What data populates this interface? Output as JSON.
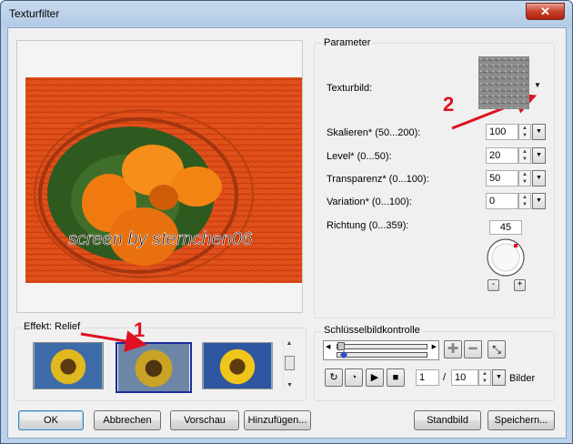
{
  "window": {
    "title": "Texturfilter",
    "close_label": "✕"
  },
  "effect": {
    "label": "Effekt: Relief"
  },
  "preview": {
    "watermark": "screen by sternchen06"
  },
  "annotations": {
    "arrow1_label": "1",
    "arrow2_label": "2",
    "color": "#e01020"
  },
  "parameter": {
    "title": "Parameter",
    "texturbild_label": "Texturbild:",
    "fields": [
      {
        "label": "Skalieren* (50...200):",
        "value": "100"
      },
      {
        "label": "Level* (0...50):",
        "value": "20"
      },
      {
        "label": "Transparenz* (0...100):",
        "value": "50"
      },
      {
        "label": "Variation* (0...100):",
        "value": "0"
      }
    ],
    "richtung_label": "Richtung (0...359):",
    "richtung_value": "45",
    "minus_label": "-",
    "plus_label": "+"
  },
  "keyframe": {
    "title": "Schlüsselbildkontrolle",
    "frame_current": "1",
    "separator": "/",
    "frame_total": "10",
    "bilder_label": "Bilder"
  },
  "buttons": {
    "ok": "OK",
    "abbrechen": "Abbrechen",
    "vorschau": "Vorschau",
    "hinzufuegen": "Hinzufügen...",
    "standbild": "Standbild",
    "speichern": "Speichern..."
  }
}
